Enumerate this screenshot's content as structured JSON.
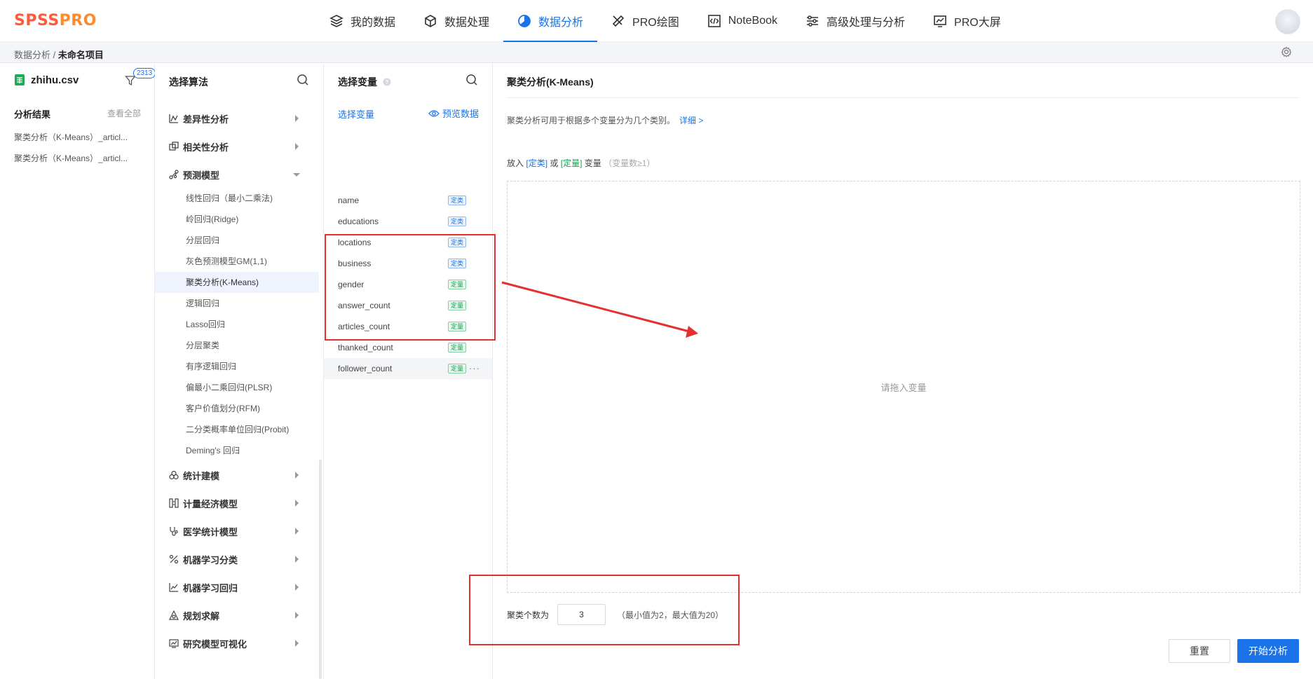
{
  "logo": {
    "part1": "SPSS",
    "part2": "PRO"
  },
  "nav": {
    "items": [
      {
        "label": "我的数据",
        "icon": "layers-icon"
      },
      {
        "label": "数据处理",
        "icon": "cube-icon"
      },
      {
        "label": "数据分析",
        "icon": "pie-chart-icon",
        "active": true
      },
      {
        "label": "PRO绘图",
        "icon": "ruler-pencil-icon"
      },
      {
        "label": "NoteBook",
        "icon": "code-file-icon"
      },
      {
        "label": "高级处理与分析",
        "icon": "sliders-icon"
      },
      {
        "label": "PRO大屏",
        "icon": "monitor-chart-icon"
      }
    ]
  },
  "breadcrumb": {
    "parent": "数据分析",
    "sep": "/",
    "current": "未命名项目"
  },
  "file": {
    "name": "zhihu.csv",
    "count": "2313"
  },
  "results": {
    "title": "分析结果",
    "view_all": "查看全部",
    "items": [
      "聚类分析（K-Means）_articl...",
      "聚类分析（K-Means）_articl..."
    ]
  },
  "algorithms": {
    "title": "选择算法",
    "categories": [
      {
        "label": "差异性分析",
        "icon": "diff-icon"
      },
      {
        "label": "相关性分析",
        "icon": "correlation-icon"
      },
      {
        "label": "预测模型",
        "icon": "predict-icon",
        "expanded": true
      }
    ],
    "sub_items": [
      "线性回归（最小二乘法)",
      "岭回归(Ridge)",
      "分层回归",
      "灰色预测模型GM(1,1)",
      "聚类分析(K-Means)",
      "逻辑回归",
      "Lasso回归",
      "分层聚类",
      "有序逻辑回归",
      "偏最小二乘回归(PLSR)",
      "客户价值划分(RFM)",
      "二分类概率单位回归(Probit)",
      "Deming's 回归"
    ],
    "active_sub": 4,
    "more_categories": [
      {
        "label": "统计建模",
        "icon": "stats-model-icon"
      },
      {
        "label": "计量经济模型",
        "icon": "econometric-icon"
      },
      {
        "label": "医学统计模型",
        "icon": "stethoscope-icon"
      },
      {
        "label": "机器学习分类",
        "icon": "percent-icon"
      },
      {
        "label": "机器学习回归",
        "icon": "trend-icon"
      },
      {
        "label": "规划求解",
        "icon": "planning-icon"
      },
      {
        "label": "研究模型可视化",
        "icon": "visual-icon"
      }
    ]
  },
  "variables": {
    "title": "选择变量",
    "sub_title": "选择变量",
    "preview": "预览数据",
    "items": [
      {
        "name": "name",
        "tag": "定类",
        "type": "dl"
      },
      {
        "name": "educations",
        "tag": "定类",
        "type": "dl"
      },
      {
        "name": "locations",
        "tag": "定类",
        "type": "dl"
      },
      {
        "name": "business",
        "tag": "定类",
        "type": "dl"
      },
      {
        "name": "gender",
        "tag": "定量",
        "type": "dz"
      },
      {
        "name": "answer_count",
        "tag": "定量",
        "type": "dz"
      },
      {
        "name": "articles_count",
        "tag": "定量",
        "type": "dz"
      },
      {
        "name": "thanked_count",
        "tag": "定量",
        "type": "dz"
      },
      {
        "name": "follower_count",
        "tag": "定量",
        "type": "dz"
      }
    ],
    "more": "···"
  },
  "method": {
    "title": "聚类分析(K-Means)",
    "description": "聚类分析可用于根据多个变量分为几个类别。",
    "detail_link": "详细 >",
    "put_prefix": "放入",
    "put_dl": "[定类]",
    "put_or": "或",
    "put_dz": "[定量]",
    "put_suffix": "变量",
    "put_note": "（变量数≥1）",
    "drop_hint": "请拖入变量",
    "k_label": "聚类个数为",
    "k_value": "3",
    "k_note": "（最小值为2，最大值为20）",
    "reset": "重置",
    "start": "开始分析"
  },
  "colors": {
    "accent": "#1a73e8",
    "annotation": "#e53030",
    "green": "#12a150",
    "logo_red": "#ff5a3c"
  }
}
